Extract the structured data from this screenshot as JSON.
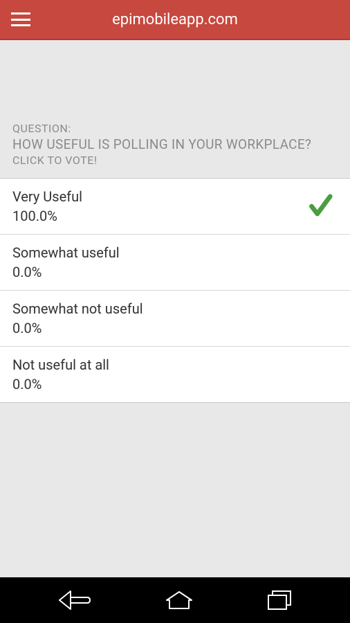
{
  "header": {
    "title": "epimobileapp.com"
  },
  "poll": {
    "label": "QUESTION:",
    "question": "HOW USEFUL IS POLLING IN YOUR WORKPLACE?",
    "cta": "CLICK TO VOTE!",
    "options": [
      {
        "label": "Very Useful",
        "percent": "100.0%",
        "selected": true
      },
      {
        "label": "Somewhat useful",
        "percent": "0.0%",
        "selected": false
      },
      {
        "label": "Somewhat not useful",
        "percent": "0.0%",
        "selected": false
      },
      {
        "label": "Not useful at all",
        "percent": "0.0%",
        "selected": false
      }
    ]
  },
  "colors": {
    "headerBg": "#c7483e",
    "checkmark": "#4a9e3f"
  }
}
